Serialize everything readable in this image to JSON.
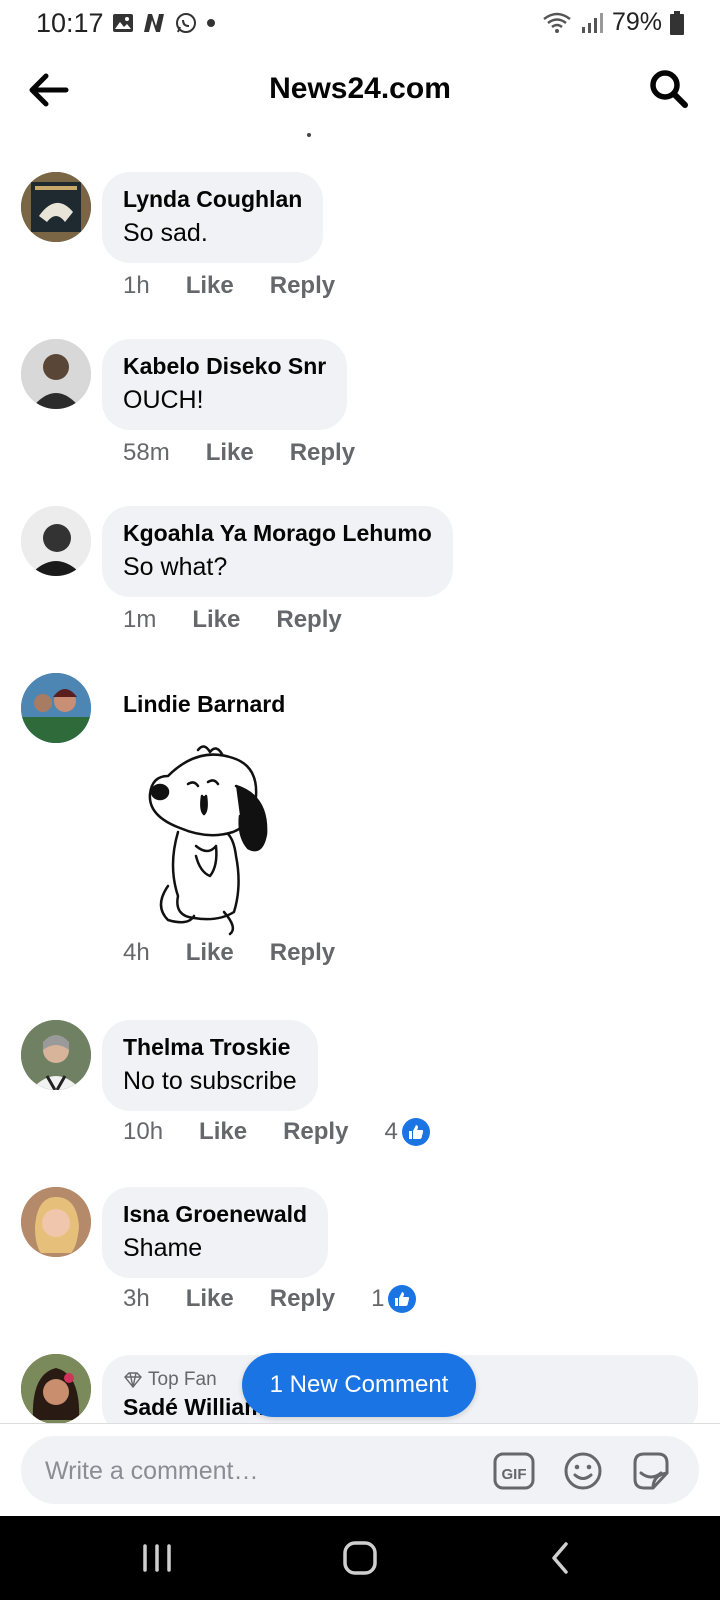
{
  "status_bar": {
    "time": "10:17",
    "battery": "79%"
  },
  "header": {
    "title": "News24.com"
  },
  "comments": [
    {
      "name": "Lynda Coughlan",
      "text": "So sad.",
      "time": "1h",
      "like": "Like",
      "reply": "Reply"
    },
    {
      "name": "Kabelo Diseko Snr",
      "text": "OUCH!",
      "time": "58m",
      "like": "Like",
      "reply": "Reply"
    },
    {
      "name": "Kgoahla Ya Morago Lehumo",
      "text": "So what?",
      "time": "1m",
      "like": "Like",
      "reply": "Reply"
    },
    {
      "name": "Lindie Barnard",
      "text": "",
      "time": "4h",
      "like": "Like",
      "reply": "Reply"
    },
    {
      "name": "Thelma Troskie",
      "text": "No to subscribe",
      "time": "10h",
      "like": "Like",
      "reply": "Reply",
      "reactions": "4"
    },
    {
      "name": "Isna Groenewald",
      "text": "Shame",
      "time": "3h",
      "like": "Like",
      "reply": "Reply",
      "reactions": "1"
    }
  ],
  "last_comment": {
    "badge": "Top Fan",
    "name": "Sadé William"
  },
  "new_comment_pill": "1 New Comment",
  "composer": {
    "placeholder": "Write a comment…"
  },
  "colors": {
    "accent": "#1b74e4",
    "bubble": "#f0f2f5",
    "meta": "#65676b"
  },
  "icons": [
    "back-arrow-icon",
    "search-icon",
    "gif-icon",
    "emoji-icon",
    "sticker-icon",
    "diamond-icon",
    "like-thumb-icon"
  ]
}
